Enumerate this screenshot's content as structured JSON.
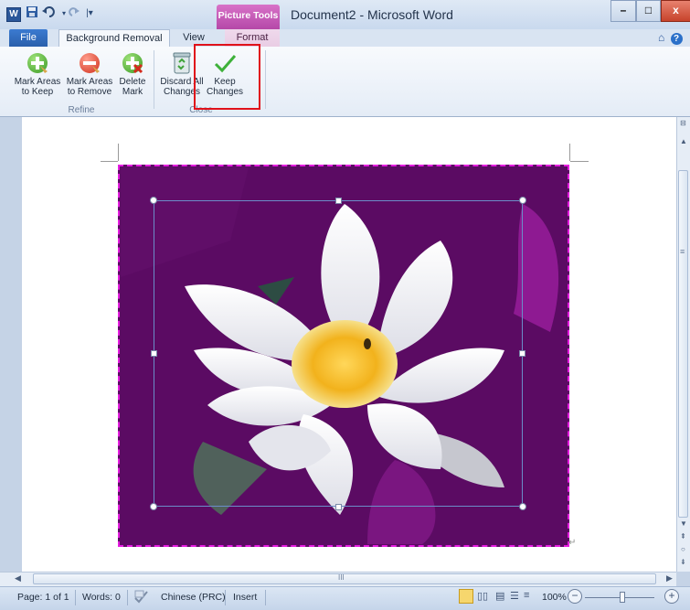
{
  "window": {
    "title": "Document2 - Microsoft Word",
    "contextual_tab_group": "Picture Tools",
    "app_icon_letter": "W",
    "minimize_glyph": "–",
    "maximize_glyph": "□",
    "close_glyph": "x"
  },
  "quick_access": {
    "save_icon": "save-icon",
    "undo_icon": "undo-icon",
    "redo_icon": "redo-icon"
  },
  "tabs": {
    "file": "File",
    "background_removal": "Background Removal",
    "view": "View",
    "format": "Format"
  },
  "ribbon": {
    "refine_group": {
      "label": "Refine",
      "mark_keep_line1": "Mark Areas",
      "mark_keep_line2": "to Keep",
      "mark_remove_line1": "Mark Areas",
      "mark_remove_line2": "to Remove",
      "delete_mark_line1": "Delete",
      "delete_mark_line2": "Mark"
    },
    "close_group": {
      "label": "Close",
      "discard_line1": "Discard All",
      "discard_line2": "Changes",
      "keep_line1": "Keep",
      "keep_line2": "Changes"
    }
  },
  "scroll": {
    "horizontal_grip": "III",
    "vertical_grip": "≡"
  },
  "status_bar": {
    "page": "Page: 1 of 1",
    "words": "Words: 0",
    "language": "Chinese (PRC)",
    "mode": "Insert",
    "zoom": "100%",
    "zoom_minus": "−",
    "zoom_plus": "+"
  },
  "colors": {
    "accent": "#2b579a",
    "picture_tools": "#c04fb4",
    "removal_overlay": "#5b0b63",
    "highlight_box": "#e0111a",
    "frame_border": "#e51ce0"
  }
}
